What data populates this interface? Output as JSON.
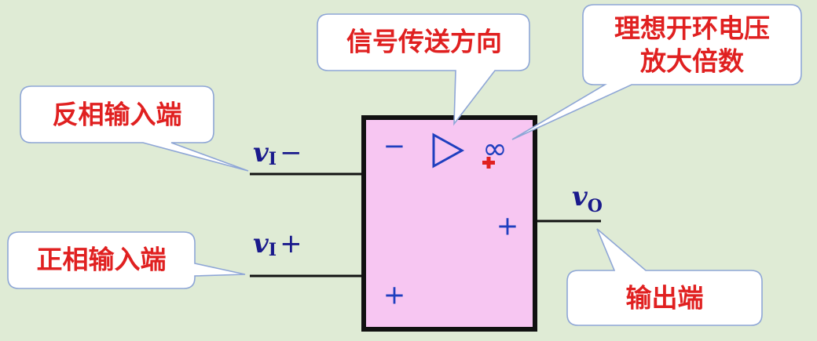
{
  "callouts": {
    "inverting_input": "反相输入端",
    "noninverting_input": "正相输入端",
    "signal_direction": "信号传送方向",
    "ideal_gain_line1": "理想开环电压",
    "ideal_gain_line2": "放大倍数",
    "output": "输出端"
  },
  "pins": {
    "inverting": {
      "symbol": "v",
      "subscript": "I",
      "sign": "−"
    },
    "noninverting": {
      "symbol": "v",
      "subscript": "I",
      "sign": "+"
    },
    "output": {
      "symbol": "v",
      "subscript": "O"
    }
  },
  "block": {
    "minus_sign": "−",
    "plus_sign_output": "+",
    "plus_sign_input": "+",
    "gain_symbol": "∞",
    "direction_icon": "triangle-arrow-icon"
  },
  "colors": {
    "background": "#dfebd5",
    "opamp_fill": "#f7c6f2",
    "callout_text": "#e02020",
    "sign_text": "#1f3fbf",
    "wire": "#111111"
  }
}
